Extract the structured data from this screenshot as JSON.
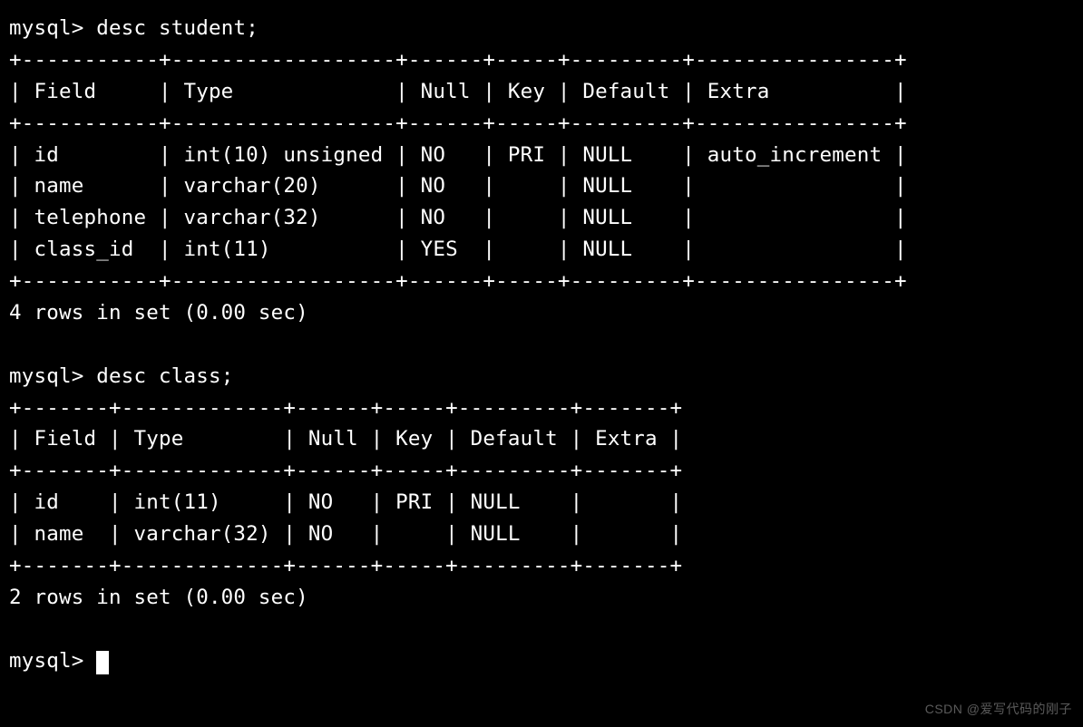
{
  "prompt": "mysql>",
  "commands": {
    "first": "desc student;",
    "second": "desc class;"
  },
  "headers": [
    "Field",
    "Type",
    "Null",
    "Key",
    "Default",
    "Extra"
  ],
  "table1": {
    "widths": [
      11,
      18,
      6,
      5,
      9,
      16
    ],
    "rows": [
      {
        "Field": "id",
        "Type": "int(10) unsigned",
        "Null": "NO",
        "Key": "PRI",
        "Default": "NULL",
        "Extra": "auto_increment"
      },
      {
        "Field": "name",
        "Type": "varchar(20)",
        "Null": "NO",
        "Key": "",
        "Default": "NULL",
        "Extra": ""
      },
      {
        "Field": "telephone",
        "Type": "varchar(32)",
        "Null": "NO",
        "Key": "",
        "Default": "NULL",
        "Extra": ""
      },
      {
        "Field": "class_id",
        "Type": "int(11)",
        "Null": "YES",
        "Key": "",
        "Default": "NULL",
        "Extra": ""
      }
    ],
    "footer": "4 rows in set (0.00 sec)"
  },
  "table2": {
    "widths": [
      7,
      13,
      6,
      5,
      9,
      7
    ],
    "rows": [
      {
        "Field": "id",
        "Type": "int(11)",
        "Null": "NO",
        "Key": "PRI",
        "Default": "NULL",
        "Extra": ""
      },
      {
        "Field": "name",
        "Type": "varchar(32)",
        "Null": "NO",
        "Key": "",
        "Default": "NULL",
        "Extra": ""
      }
    ],
    "footer": "2 rows in set (0.00 sec)"
  },
  "watermark": "CSDN @爱写代码的刚子"
}
